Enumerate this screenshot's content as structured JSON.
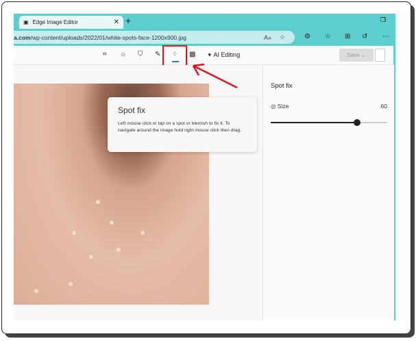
{
  "browser": {
    "tab_title": "Edge Image Editor",
    "url_domain": "a.com",
    "url_path": "/wp-content/uploads/2022/01/white-spots-face-1200x900.jpg"
  },
  "toolbar": {
    "items": [
      "crop",
      "adjust",
      "filter",
      "markup",
      "spot-fix",
      "background-blur"
    ],
    "ai_editing": "AI Editing",
    "save": "Save"
  },
  "panel": {
    "title": "Spot fix",
    "size_label": "Size",
    "size_value": "60",
    "slider_fraction": 0.74
  },
  "tooltip": {
    "title": "Spot fix",
    "body": "Left mouse click or tap on a spot or blemish to fix it. To navigate around the image hold right mouse click then drag."
  },
  "colors": {
    "accent": "#5dcdce",
    "highlight": "#e0141b"
  }
}
